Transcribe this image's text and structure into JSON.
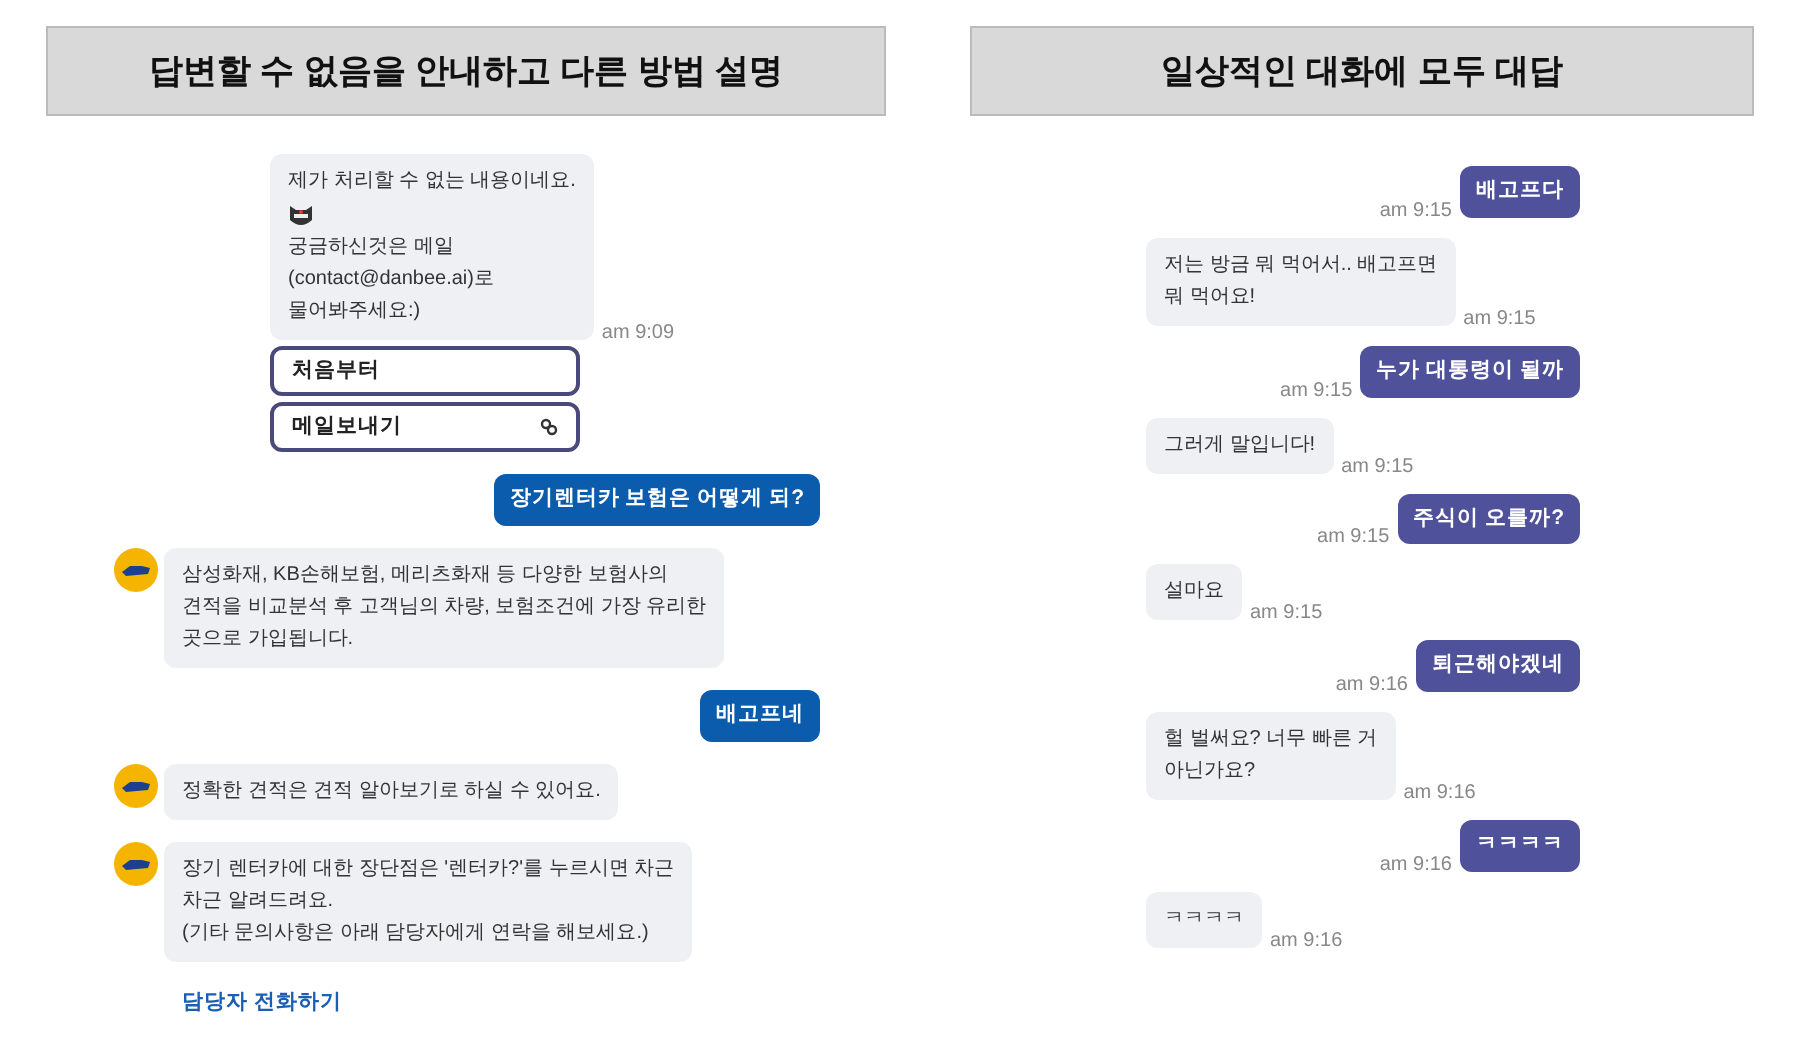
{
  "panels": [
    {
      "title": "답변할 수 없음을 안내하고 다른 방법 설명",
      "kind": "service",
      "messages": [
        {
          "kind": "bot",
          "avatar": false,
          "lines": [
            {
              "kind": "text",
              "text": "제가 처리할 수 없는 내용이네요."
            },
            {
              "kind": "emoji"
            },
            {
              "kind": "text",
              "text": "궁금하신것은 메일\n(contact@danbee.ai)로\n물어봐주세요:)"
            }
          ],
          "time": "am 9:09"
        },
        {
          "kind": "button",
          "label": "처음부터",
          "link_icon": false
        },
        {
          "kind": "button",
          "label": "메일보내기",
          "link_icon": true
        },
        {
          "kind": "user",
          "text": "장기렌터카 보험은 어떻게 되?"
        },
        {
          "kind": "bot",
          "avatar": true,
          "lines": [
            {
              "kind": "text",
              "text": "삼성화재, KB손해보험, 메리츠화재 등 다양한 보험사의\n견적을 비교분석 후 고객님의 차량, 보험조건에 가장 유리한\n곳으로 가입됩니다."
            }
          ]
        },
        {
          "kind": "user",
          "text": "배고프네"
        },
        {
          "kind": "bot",
          "avatar": true,
          "lines": [
            {
              "kind": "text",
              "text": "정확한 견적은 견적 알아보기로 하실 수 있어요."
            }
          ]
        },
        {
          "kind": "bot",
          "avatar": true,
          "lines": [
            {
              "kind": "text",
              "text": "장기 렌터카에 대한 장단점은 '렌터카?'를 누르시면 차근\n차근 알려드려요.\n(기타 문의사항은 아래 담당자에게 연락을 해보세요.)"
            }
          ]
        },
        {
          "kind": "link",
          "label": "담당자 전화하기"
        }
      ]
    },
    {
      "title": "일상적인 대화에 모두 대답",
      "kind": "smalltalk",
      "messages": [
        {
          "kind": "user",
          "text": "배고프다",
          "time": "am 9:15"
        },
        {
          "kind": "bot",
          "avatar": false,
          "lines": [
            {
              "kind": "text",
              "text": "저는 방금 뭐 먹어서.. 배고프면\n뭐 먹어요!"
            }
          ],
          "time": "am 9:15"
        },
        {
          "kind": "user",
          "text": "누가 대통령이 될까",
          "time": "am 9:15"
        },
        {
          "kind": "bot",
          "avatar": false,
          "lines": [
            {
              "kind": "text",
              "text": "그러게 말입니다!"
            }
          ],
          "time": "am 9:15"
        },
        {
          "kind": "user",
          "text": "주식이 오를까?",
          "time": "am 9:15"
        },
        {
          "kind": "bot",
          "avatar": false,
          "lines": [
            {
              "kind": "text",
              "text": "설마요"
            }
          ],
          "time": "am 9:15"
        },
        {
          "kind": "user",
          "text": "퇴근해야겠네",
          "time": "am 9:16"
        },
        {
          "kind": "bot",
          "avatar": false,
          "lines": [
            {
              "kind": "text",
              "text": "헐 벌써요? 너무 빠른 거\n아닌가요?"
            }
          ],
          "time": "am 9:16"
        },
        {
          "kind": "user",
          "text": "ㅋㅋㅋㅋ",
          "time": "am 9:16"
        },
        {
          "kind": "bot",
          "avatar": false,
          "lines": [
            {
              "kind": "text",
              "text": "ㅋㅋㅋㅋ"
            }
          ],
          "time": "am 9:16"
        }
      ]
    }
  ]
}
